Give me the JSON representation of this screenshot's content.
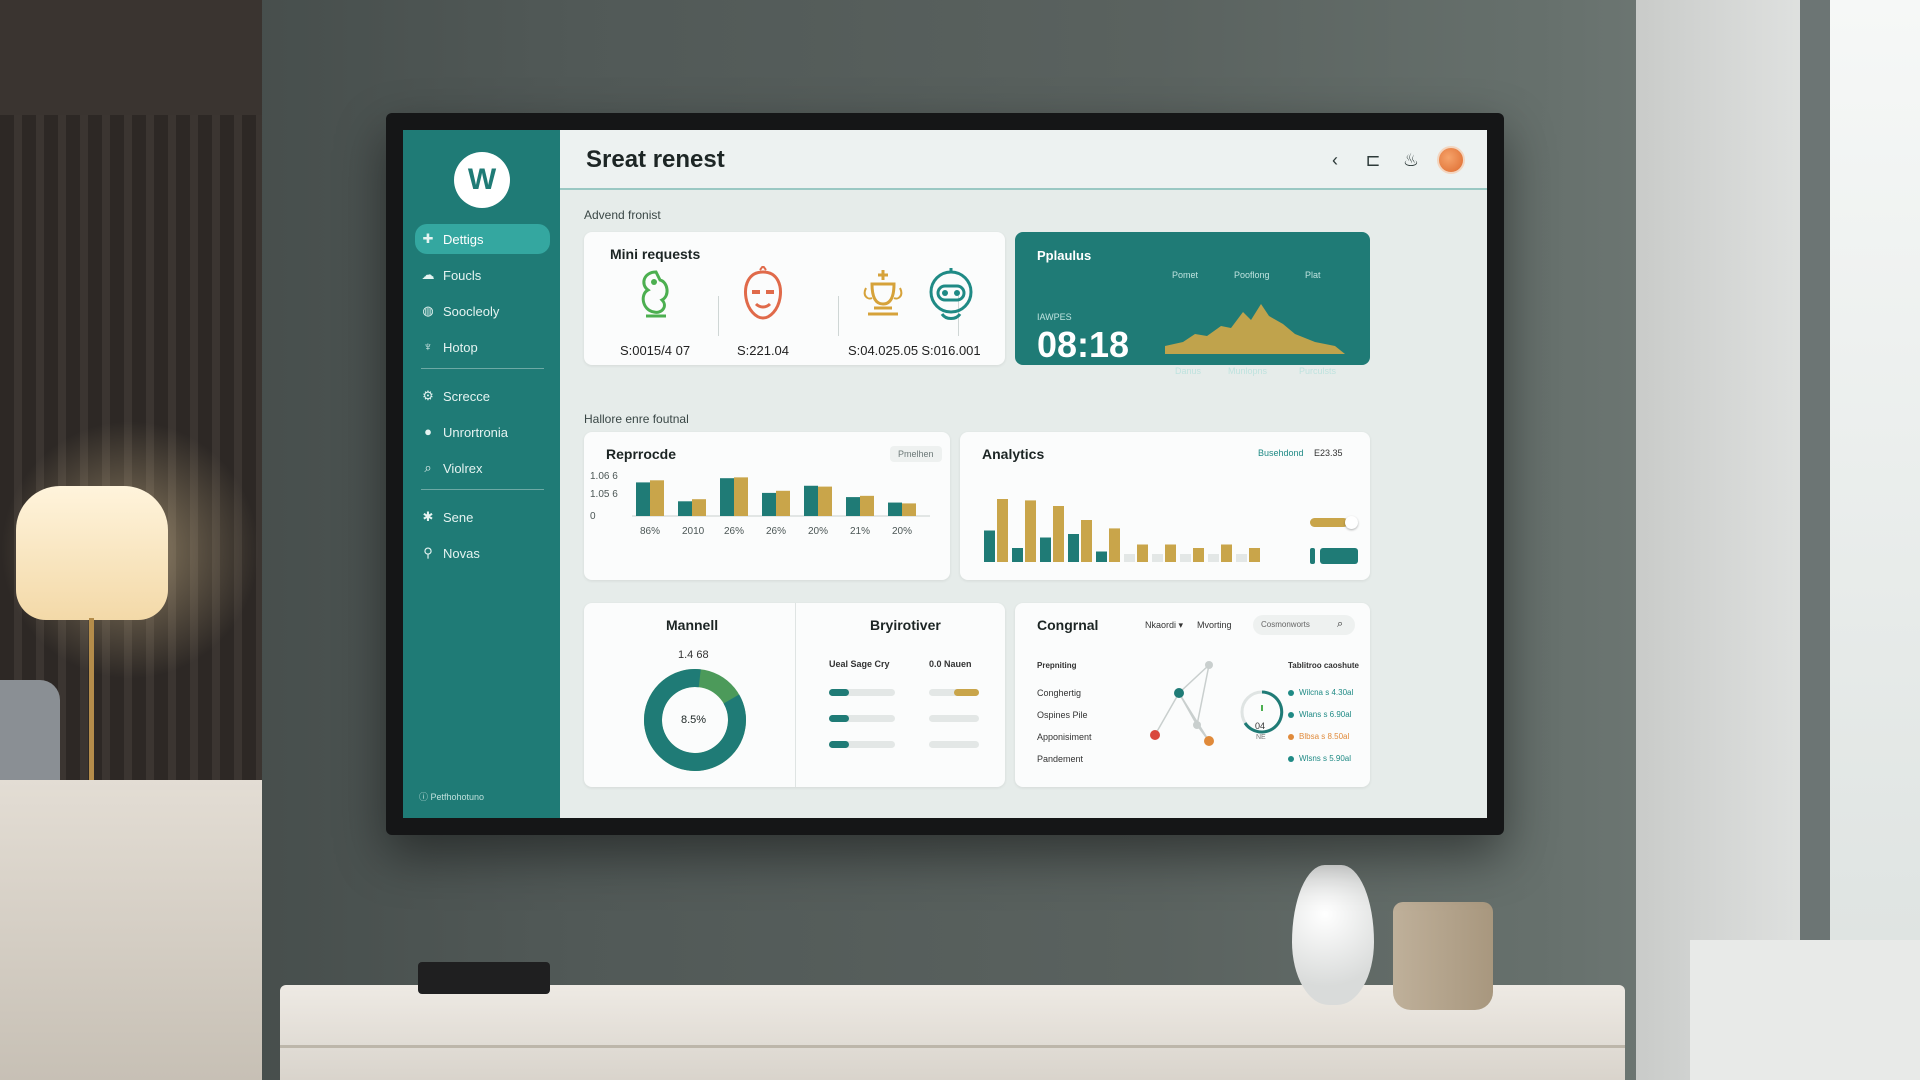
{
  "colors": {
    "teal": "#1f7b76",
    "teal_light": "#34a7a0",
    "gold": "#c9a54a",
    "red": "#d9473c",
    "orange": "#e08a3a",
    "green": "#4caf50"
  },
  "sidebar": {
    "logo": "W",
    "items": [
      {
        "label": "Dettigs",
        "icon": "crosshair-icon",
        "active": true
      },
      {
        "label": "Foucls",
        "icon": "cloud-icon"
      },
      {
        "label": "Soocleoly",
        "icon": "globe-icon"
      },
      {
        "label": "Hotop",
        "icon": "pin-icon"
      },
      {
        "label": "Screcce",
        "icon": "gear-icon"
      },
      {
        "label": "Unrortronia",
        "icon": "circle-icon"
      },
      {
        "label": "Violrex",
        "icon": "search-icon"
      },
      {
        "label": "Sene",
        "icon": "star-icon"
      },
      {
        "label": "Novas",
        "icon": "location-icon"
      }
    ],
    "footer": "Petfhohotuno"
  },
  "header": {
    "title": "Sreat renest"
  },
  "sections": {
    "top_label": "Advend fronist",
    "mid_label": "Hallore enre foutnal"
  },
  "mini_requests": {
    "title": "Mini requests",
    "items": [
      {
        "value": "S:0015/4 07",
        "icon": "seahorse-icon",
        "color": "#4caf50"
      },
      {
        "value": "S:221.04",
        "icon": "mask-icon",
        "color": "#e06a4a"
      },
      {
        "value": "S:04.025.05",
        "icon": "trophy-icon",
        "color": "#d6a23a"
      },
      {
        "value": "S:016.001",
        "icon": "robot-icon",
        "color": "#1f8a85"
      }
    ]
  },
  "pplaulus": {
    "title": "Pplaulus",
    "col_labels": [
      "Pomet",
      "Pooflong",
      "Plat"
    ],
    "small_label": "IAWPES",
    "time": "08:18",
    "bottom_labels": [
      "Danus",
      "Munlopns",
      "Purculsts"
    ]
  },
  "reprocde": {
    "title": "Reprrocde",
    "tag": "Pmelhen",
    "chart_data": {
      "type": "bar",
      "title": "Reprrocde",
      "categories": [
        "86%",
        "2010",
        "26%",
        "26%",
        "20%",
        "21%",
        "20%"
      ],
      "y_ticks": [
        "1.06 6",
        "1.05 6",
        "0"
      ],
      "series": [
        {
          "values": [
            0.8,
            0.35,
            0.9,
            0.55,
            0.72,
            0.45,
            0.32
          ],
          "color": "#1f7b76"
        },
        {
          "values": [
            0.85,
            0.4,
            0.92,
            0.6,
            0.7,
            0.48,
            0.3
          ],
          "color": "#c9a54a"
        }
      ]
    }
  },
  "analytics": {
    "title": "Analytics",
    "link": "Busehdond",
    "value": "E23.35",
    "chart_data": {
      "type": "bar",
      "title": "Analytics",
      "series": [
        {
          "values": [
            0.45,
            0.2,
            0.35,
            0.4,
            0.15,
            0,
            0,
            0,
            0,
            0
          ],
          "color": "#1f7b76"
        },
        {
          "values": [
            0.9,
            0.88,
            0.8,
            0.6,
            0.48,
            0.25,
            0.25,
            0.2,
            0.25,
            0.2
          ],
          "color": "#c9a54a"
        }
      ],
      "toggle_value": 0.8
    }
  },
  "mannell": {
    "title": "Mannell",
    "value": "1.4 68",
    "center": "8.5%",
    "chart_data": {
      "type": "pie",
      "values": [
        0.85,
        0.15
      ]
    }
  },
  "bryirotiver": {
    "title": "Bryirotiver",
    "col1": "Ueal Sage Cry",
    "col2": "0.0 Nauen",
    "bars": [
      {
        "left": 0.3,
        "right": 0.5
      },
      {
        "left": 0.3,
        "right": 0
      },
      {
        "left": 0.3,
        "right": 0
      }
    ]
  },
  "congrnal": {
    "title": "Congrnal",
    "dropdown": "Nkaordi",
    "tab": "Mvorting",
    "search_placeholder": "Cosmonworts",
    "rows_header": "Prepniting",
    "rows": [
      "Conghertig",
      "Ospines Pile",
      "Apponisiment",
      "Pandement"
    ],
    "gauge_value": "04",
    "gauge_sub": "NE",
    "right_header": "Tablitroo caoshute",
    "right_items": [
      {
        "label": "Wilcna s 4.30al",
        "color": "#1f8a85"
      },
      {
        "label": "Wlans s 6.90al",
        "color": "#1f8a85"
      },
      {
        "label": "Blbsa s 8.50al",
        "color": "#e08a3a"
      },
      {
        "label": "Wlsns s 5.90al",
        "color": "#1f8a85"
      }
    ]
  }
}
